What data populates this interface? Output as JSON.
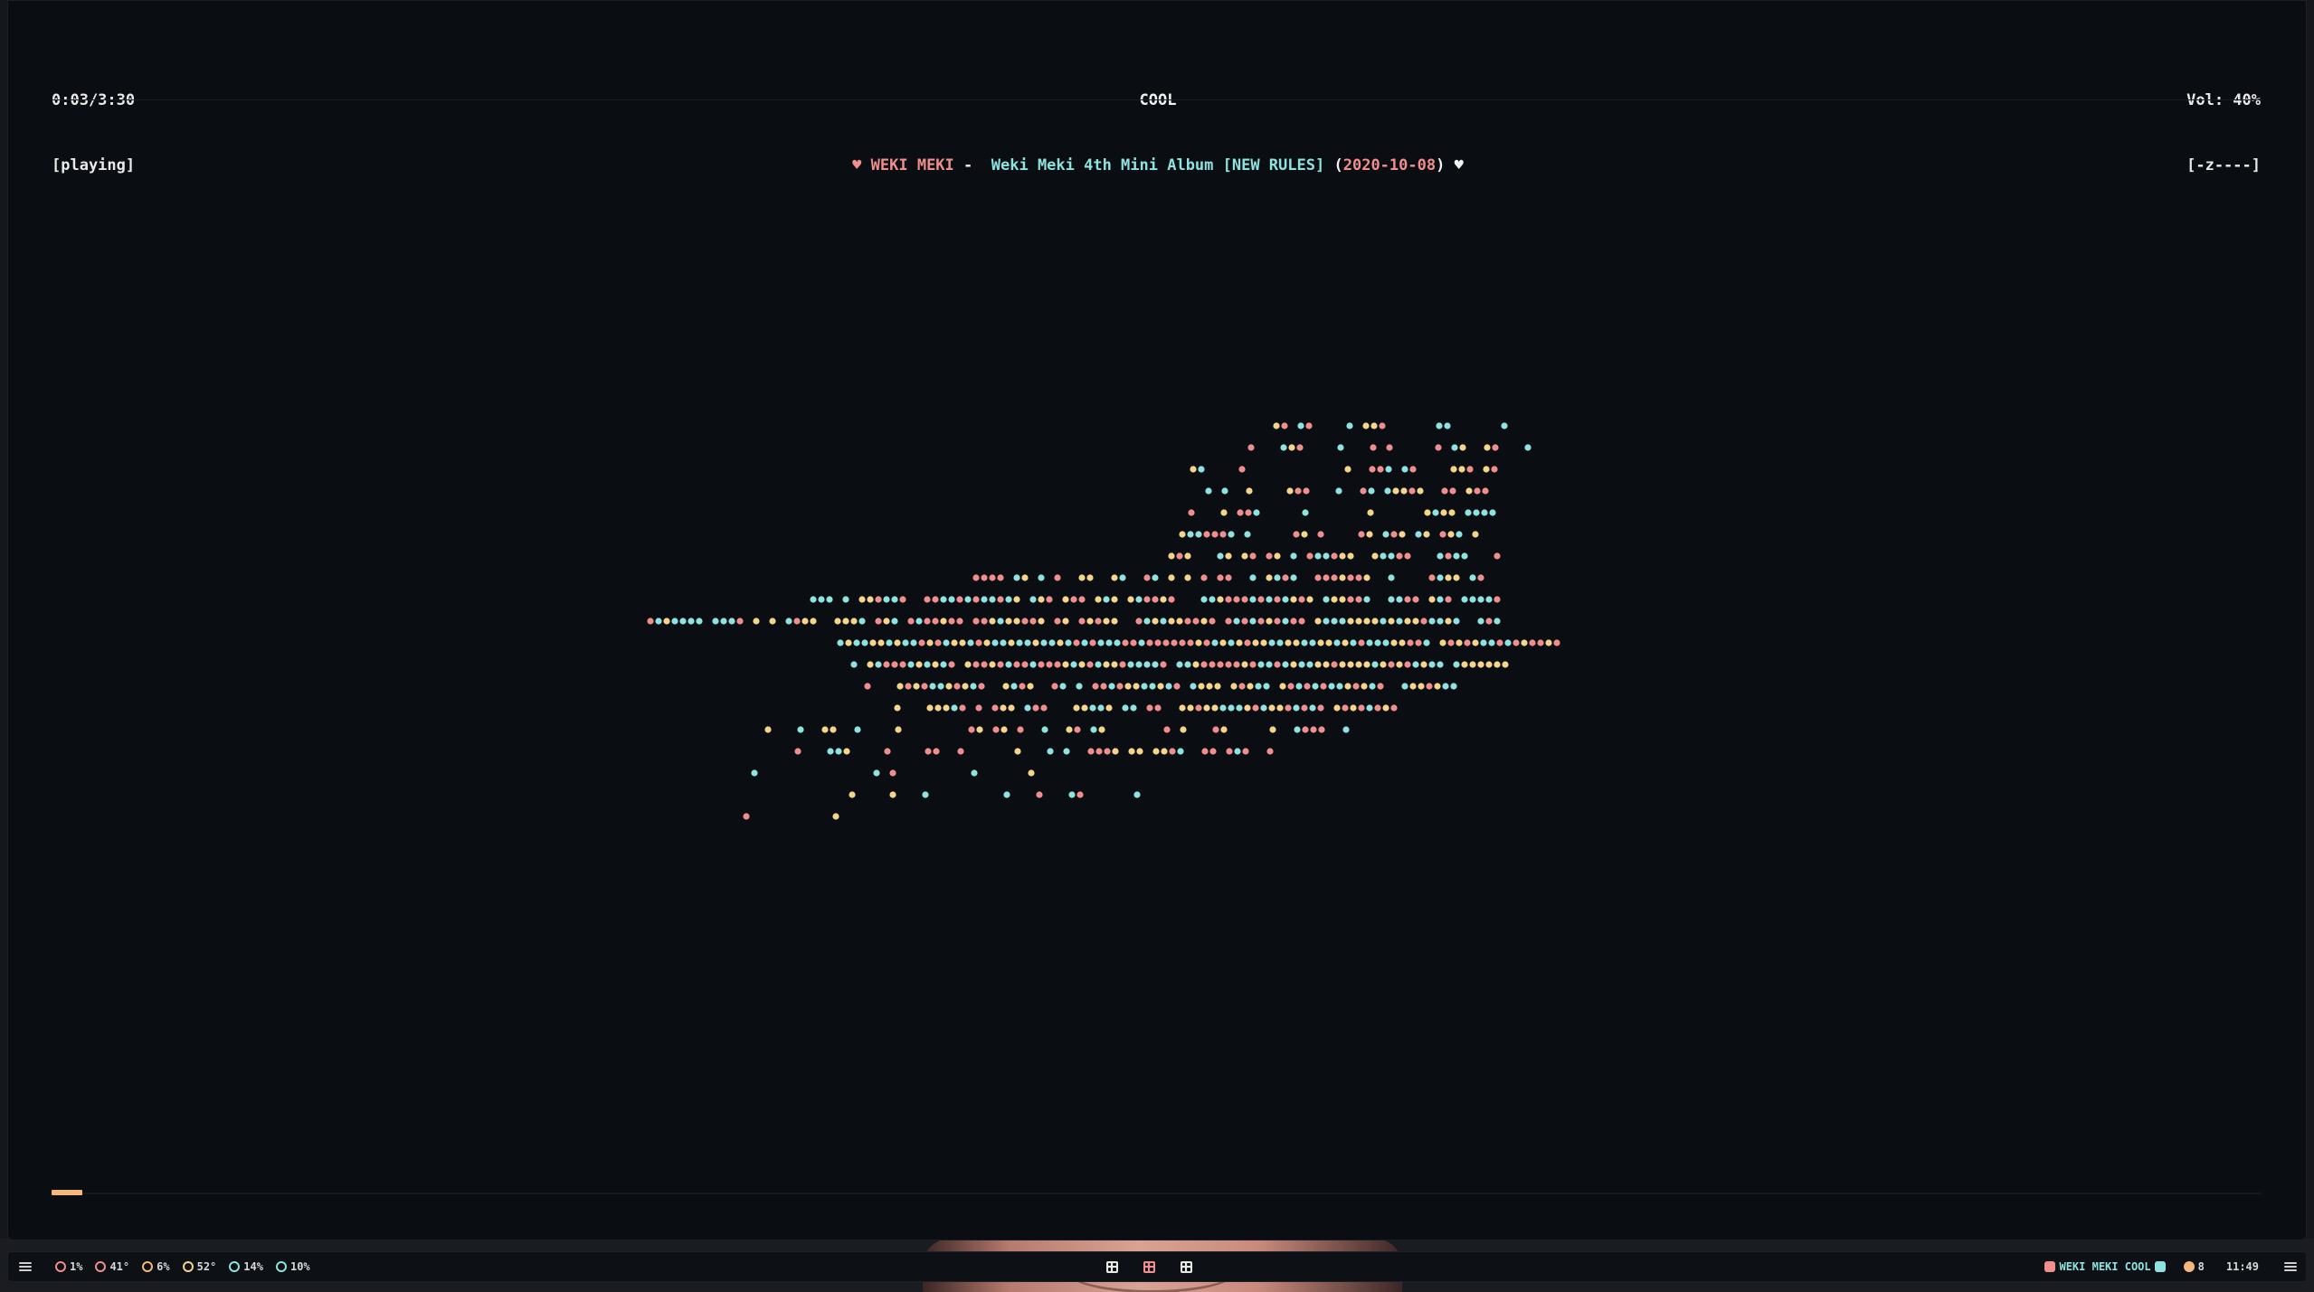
{
  "player": {
    "time": "0:03/3:30",
    "state": "[playing]",
    "title": "COOL",
    "artist": "WEKI MEKI",
    "separator": "-",
    "album": "Weki Meki 4th Mini Album [NEW RULES]",
    "date": "2020-10-08",
    "volume": "Vol: 40%",
    "volume_bar": "[-z----]",
    "progress": 0.014
  },
  "colors": {
    "pink": "#f08e8e",
    "cyan": "#8ee3e0",
    "yellow": "#f4d58a",
    "progress": "#f5b77b",
    "background": "#0a0d11"
  },
  "visualizer": {
    "symbol": "●",
    "palette": [
      "#f08e8e",
      "#8ee3e0",
      "#f4d58a"
    ]
  },
  "statusbar": {
    "left": [
      {
        "icon": "cpu-icon",
        "color": "#f08e8e",
        "value": "1%"
      },
      {
        "icon": "temperature-icon",
        "color": "#f08e8e",
        "value": "41°"
      },
      {
        "icon": "gpu-icon",
        "color": "#f5b77b",
        "value": "6%"
      },
      {
        "icon": "gpu-temperature-icon",
        "color": "#f4d58a",
        "value": "52°"
      },
      {
        "icon": "memory-icon",
        "color": "#8ee3e0",
        "value": "14%"
      },
      {
        "icon": "storage-icon",
        "color": "#8ee3e0",
        "value": "10%"
      }
    ],
    "workspaces": [
      "1",
      "2",
      "3"
    ],
    "now_playing": "WEKI MEKI COOL",
    "updates_count": "8",
    "clock": "11:49"
  }
}
